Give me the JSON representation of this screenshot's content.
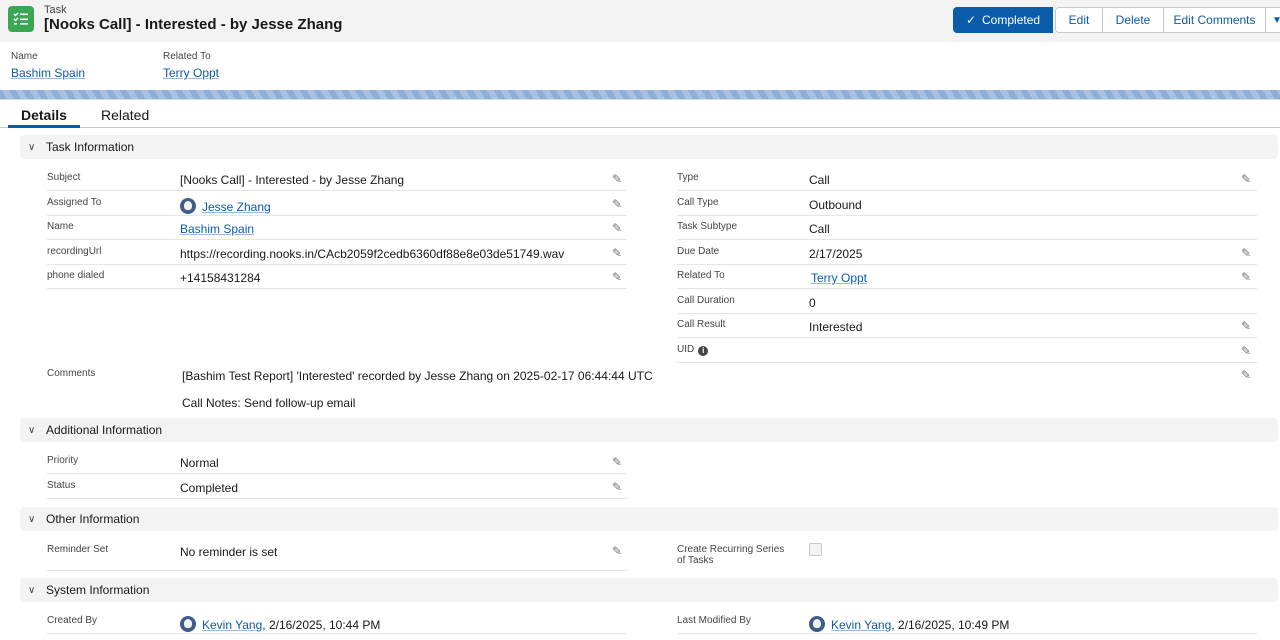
{
  "header": {
    "entity": "Task",
    "title": "[Nooks Call] - Interested - by Jesse Zhang",
    "buttons": {
      "completed": "Completed",
      "edit": "Edit",
      "delete": "Delete",
      "edit_comments": "Edit Comments"
    }
  },
  "highlights": {
    "name_label": "Name",
    "name_value": "Bashim Spain",
    "related_label": "Related To",
    "related_value": "Terry Oppt"
  },
  "tabs": {
    "details": "Details",
    "related": "Related"
  },
  "sections": {
    "task_info": "Task Information",
    "additional": "Additional Information",
    "other": "Other Information",
    "system": "System Information"
  },
  "task_info": {
    "subject": {
      "label": "Subject",
      "value": "[Nooks Call] - Interested - by Jesse Zhang"
    },
    "assigned_to": {
      "label": "Assigned To",
      "value": "Jesse Zhang"
    },
    "name": {
      "label": "Name",
      "value": "Bashim Spain"
    },
    "recording_url": {
      "label": "recordingUrl",
      "value": "https://recording.nooks.in/CAcb2059f2cedb6360df88e8e03de51749.wav"
    },
    "phone_dialed": {
      "label": "phone dialed",
      "value": "+14158431284"
    },
    "type": {
      "label": "Type",
      "value": "Call"
    },
    "call_type": {
      "label": "Call Type",
      "value": "Outbound"
    },
    "task_subtype": {
      "label": "Task Subtype",
      "value": "Call"
    },
    "due_date": {
      "label": "Due Date",
      "value": "2/17/2025"
    },
    "related_to": {
      "label": "Related To",
      "value": "Terry Oppt"
    },
    "call_duration": {
      "label": "Call Duration",
      "value": "0"
    },
    "call_result": {
      "label": "Call Result",
      "value": "Interested"
    },
    "uid": {
      "label": "UID",
      "value": ""
    },
    "comments": {
      "label": "Comments",
      "line1": "[Bashim Test Report] 'Interested' recorded by Jesse Zhang on 2025-02-17 06:44:44 UTC",
      "line2": "Call Notes: Send follow-up email"
    }
  },
  "additional": {
    "priority": {
      "label": "Priority",
      "value": "Normal"
    },
    "status": {
      "label": "Status",
      "value": "Completed"
    }
  },
  "other": {
    "reminder": {
      "label": "Reminder Set",
      "value": "No reminder is set"
    },
    "recurring": {
      "label_line1": "Create Recurring Series",
      "label_line2": "of Tasks",
      "checked": false
    }
  },
  "system": {
    "created_by": {
      "label": "Created By",
      "user": "Kevin Yang",
      "date": ", 2/16/2025, 10:44 PM"
    },
    "last_modified_by": {
      "label": "Last Modified By",
      "user": "Kevin Yang",
      "date": ", 2/16/2025, 10:49 PM"
    }
  },
  "icons": {
    "task": "task-list-icon",
    "edit": "pencil-icon",
    "info": "info-icon",
    "chevron": "chevron-down-icon",
    "check": "check-icon"
  },
  "colors": {
    "brand": "#0b5cab",
    "task_icon": "#3ba755"
  }
}
